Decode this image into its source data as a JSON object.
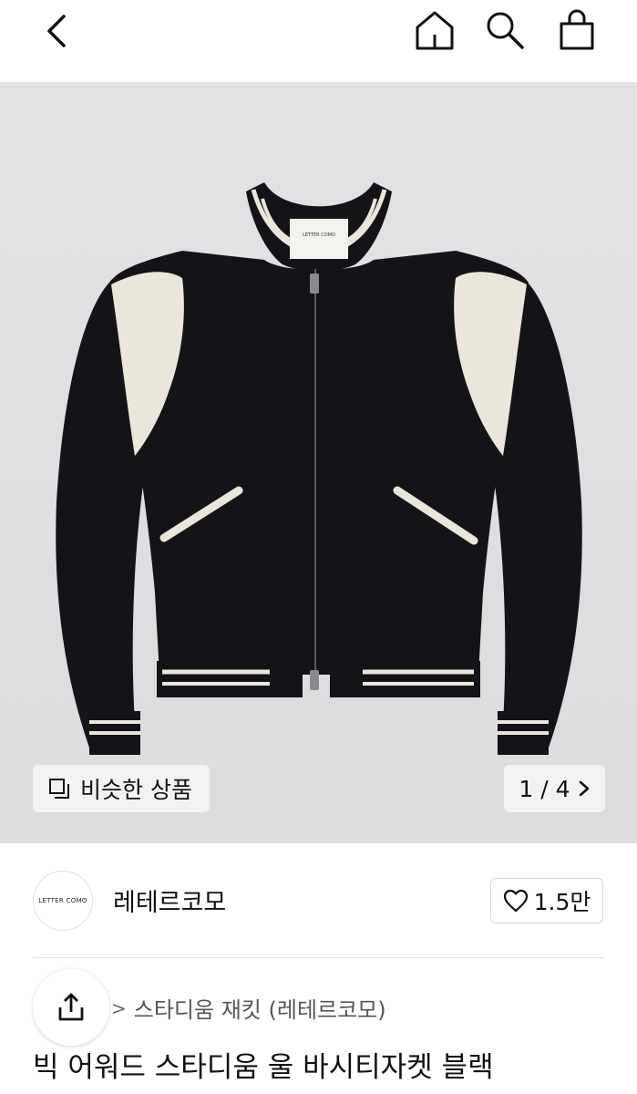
{
  "colors": {
    "hero_background": "#dfdfe1",
    "jacket_body": "#141418",
    "jacket_accent": "#ebe6dc",
    "chip_background": "#f2f2f2"
  },
  "topbar": {
    "icons": [
      "back-icon",
      "home-icon",
      "search-icon",
      "bag-icon"
    ]
  },
  "gallery": {
    "similar_label": "비슷한 상품",
    "pager_text": "1 / 4",
    "jacket_tag_text": "LETTER COMO"
  },
  "brand": {
    "logo_text": "LETTER COMO",
    "name": "레테르코모",
    "likes": "1.5만"
  },
  "product": {
    "category": "스타디움 재킷 (레테르코모)",
    "title": "빅 어워드 스타디움 울 바시티자켓 블랙"
  }
}
